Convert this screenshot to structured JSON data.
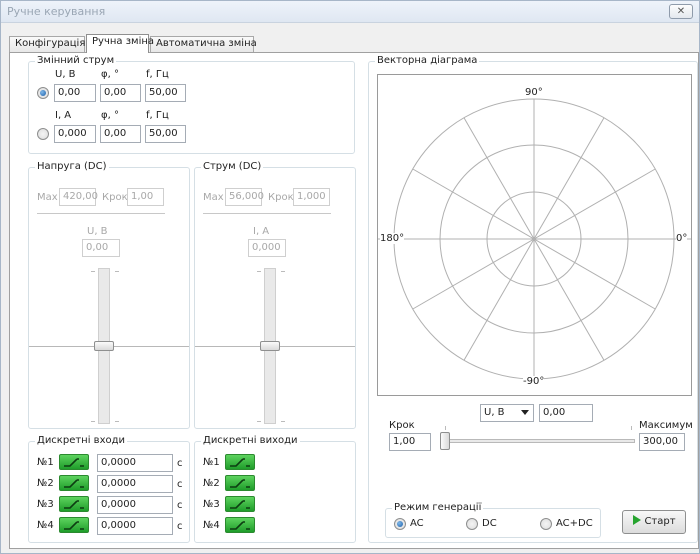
{
  "window": {
    "title": "Ручне керування",
    "close_glyph": "✕"
  },
  "tabs": [
    {
      "label": "Конфігурація"
    },
    {
      "label": "Ручна зміна"
    },
    {
      "label": "Автоматична зміна"
    }
  ],
  "ac": {
    "group_label": "Змінний струм",
    "u_row": {
      "h1": "U, В",
      "h2": "φ, °",
      "h3": "f, Гц",
      "v1": "0,00",
      "v2": "0,00",
      "v3": "50,00",
      "selected": true
    },
    "i_row": {
      "h1": "I, A",
      "h2": "φ, °",
      "h3": "f, Гц",
      "v1": "0,000",
      "v2": "0,00",
      "v3": "50,00",
      "selected": false
    }
  },
  "dc_voltage": {
    "group_label": "Напруга (DC)",
    "max_label": "Max",
    "max_value": "420,00",
    "step_label": "Крок",
    "step_value": "1,00",
    "unit_label": "U, В",
    "value": "0,00",
    "slider_level": 0.0
  },
  "dc_current": {
    "group_label": "Струм (DC)",
    "max_label": "Max",
    "max_value": "56,000",
    "step_label": "Крок",
    "step_value": "1,000",
    "unit_label": "I, A",
    "value": "0,000",
    "slider_level": 0.0
  },
  "inputs": {
    "group_label": "Дискретні входи",
    "items": [
      {
        "label": "№1",
        "value": "0,0000",
        "unit": "с"
      },
      {
        "label": "№2",
        "value": "0,0000",
        "unit": "с"
      },
      {
        "label": "№3",
        "value": "0,0000",
        "unit": "с"
      },
      {
        "label": "№4",
        "value": "0,0000",
        "unit": "с"
      }
    ]
  },
  "outputs": {
    "group_label": "Дискретні виходи",
    "items": [
      {
        "label": "№1"
      },
      {
        "label": "№2"
      },
      {
        "label": "№3"
      },
      {
        "label": "№4"
      }
    ]
  },
  "vector": {
    "group_label": "Векторна діаграма",
    "angle_top": "90°",
    "angle_left": "180°",
    "angle_right": "0°",
    "angle_bottom": "-90°",
    "combo_value": "U, В",
    "combo_input": "0,00",
    "step_label": "Крок",
    "step_value": "1,00",
    "max_label": "Максимум",
    "max_value": "300,00",
    "slider_level": 0.0
  },
  "generation": {
    "group_label": "Режим генерації",
    "options": [
      {
        "label": "AC",
        "checked": true
      },
      {
        "label": "DC",
        "checked": false
      },
      {
        "label": "AC+DC",
        "checked": false
      }
    ],
    "start_label": "Старт",
    "colors": {
      "led_green": "#1f9d2a",
      "start_arrow": "#27a42f",
      "radio_dot": "#1d5fa8"
    }
  }
}
